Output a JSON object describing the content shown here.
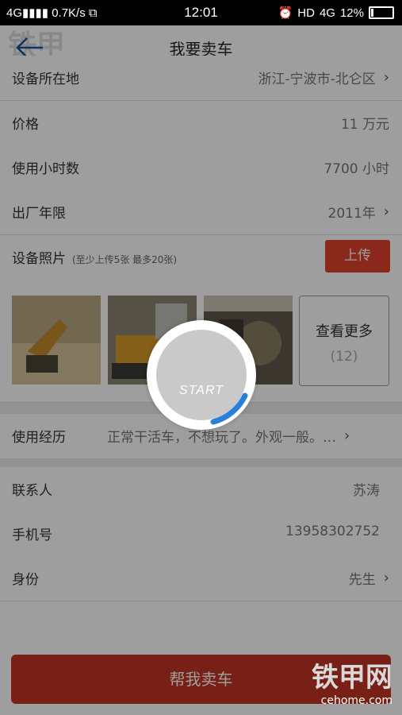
{
  "status_bar": {
    "network": "4G",
    "speed": "0.7K/s",
    "time": "12:01",
    "hd": "HD",
    "net2": "4G",
    "battery": "12%"
  },
  "header": {
    "title": "我要卖车",
    "watermark": "铁甲 CEhome.com"
  },
  "fields": {
    "location": {
      "label": "设备所在地",
      "value": "浙江-宁波市-北仑区"
    },
    "price": {
      "label": "价格",
      "value": "11 万元"
    },
    "hours": {
      "label": "使用小时数",
      "value": "7700 小时"
    },
    "year": {
      "label": "出厂年限",
      "value": "2011年"
    },
    "photos": {
      "label": "设备照片",
      "hint": "(至少上传5张 最多20张)",
      "upload_label": "上传"
    },
    "experience": {
      "label": "使用经历",
      "value": "正常干活车，不想玩了。外观一般。…"
    },
    "contact": {
      "label": "联系人",
      "value": "苏涛"
    },
    "phone": {
      "label": "手机号",
      "value": "13958302752"
    },
    "identity": {
      "label": "身份",
      "value": "先生"
    }
  },
  "gallery": {
    "more_label": "查看更多",
    "more_count": "(12)"
  },
  "submit_label": "帮我卖车",
  "loader": {
    "text": "START"
  },
  "brand": {
    "name": "铁甲网",
    "url": "cehome.com"
  },
  "colors": {
    "accent": "#e0412e",
    "header_line": "#1f4f9a",
    "progress": "#2a7fd8"
  }
}
